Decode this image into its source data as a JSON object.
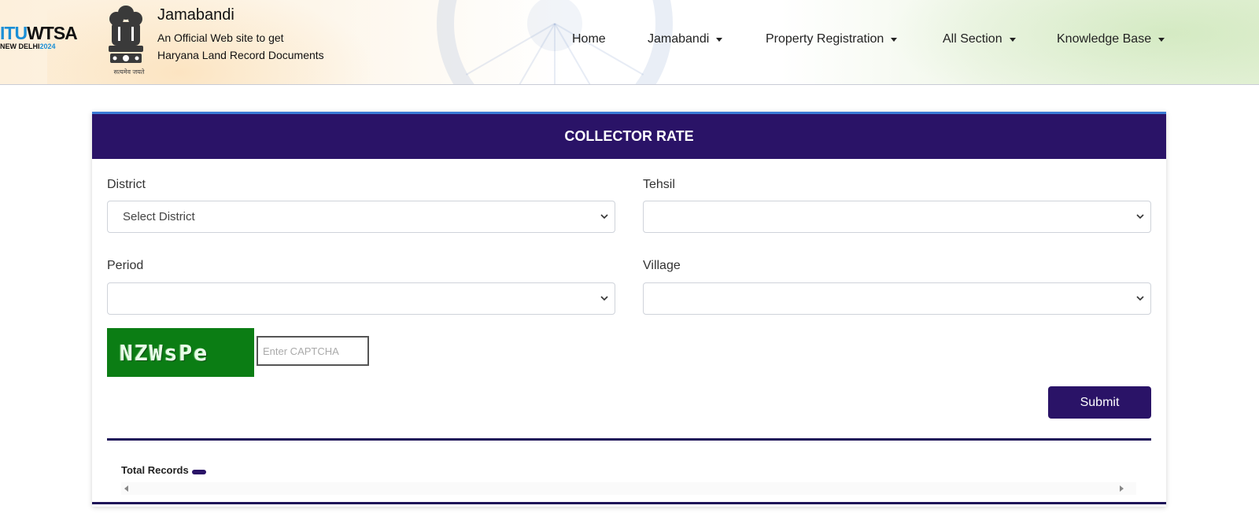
{
  "header": {
    "itu_logo": {
      "part1": "ITU",
      "part2": "WTSA",
      "city": "NEW DELHI",
      "year": "2024"
    },
    "emblem_motto": "सत्यमेव जयते",
    "site_title": "Jamabandi",
    "site_subtitle_line1": "An Official Web site to get",
    "site_subtitle_line2": "Haryana Land Record Documents"
  },
  "nav": {
    "items": [
      {
        "label": "Home",
        "dropdown": false
      },
      {
        "label": "Jamabandi",
        "dropdown": true
      },
      {
        "label": "Property Registration",
        "dropdown": true
      },
      {
        "label": "All Section",
        "dropdown": true
      },
      {
        "label": "Knowledge Base",
        "dropdown": true
      }
    ]
  },
  "form": {
    "title": "COLLECTOR RATE",
    "district": {
      "label": "District",
      "value": "Select District"
    },
    "tehsil": {
      "label": "Tehsil",
      "value": ""
    },
    "period": {
      "label": "Period",
      "value": ""
    },
    "village": {
      "label": "Village",
      "value": ""
    },
    "captcha": {
      "code": "NZWsPe",
      "placeholder": "Enter CAPTCHA",
      "value": ""
    },
    "submit_label": "Submit"
  },
  "results": {
    "total_label": "Total Records",
    "total_value": ""
  },
  "colors": {
    "primary": "#2a1367",
    "captcha_bg": "#0b7d14",
    "accent_border": "#3a7bd5"
  }
}
